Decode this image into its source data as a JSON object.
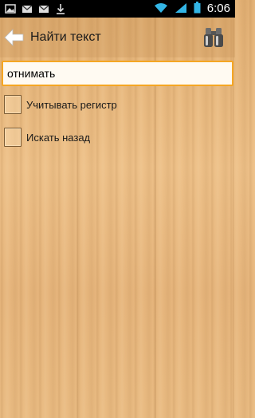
{
  "status_bar": {
    "time": "6:06",
    "icons": [
      "image-icon",
      "gmail-icon",
      "gmail-icon",
      "download-icon",
      "wifi-icon",
      "signal-icon",
      "battery-icon"
    ]
  },
  "action_bar": {
    "title": "Найти текст",
    "back_icon": "back-arrow-icon",
    "action_icon": "binoculars-icon"
  },
  "search": {
    "value": "отнимать"
  },
  "options": {
    "match_case": {
      "label": "Учитывать регистр",
      "checked": false
    },
    "search_backward": {
      "label": "Искать назад",
      "checked": false
    }
  },
  "colors": {
    "input_border": "#f5a623",
    "spell_underline": "#e0221c",
    "wood_background": "#e8b87a"
  }
}
